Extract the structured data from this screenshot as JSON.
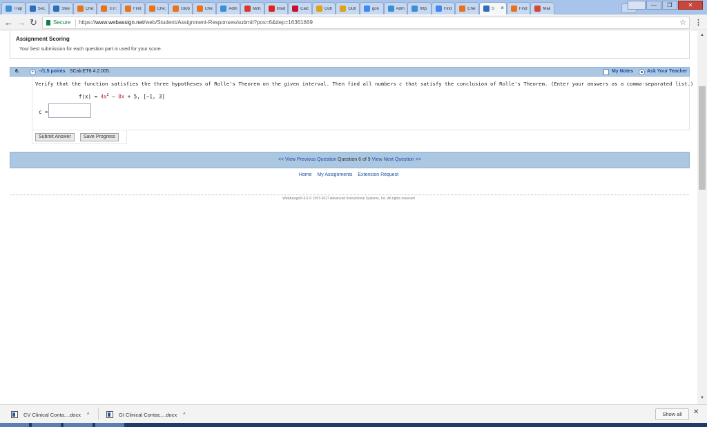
{
  "browser": {
    "tabs": [
      {
        "label": "Trap",
        "icon": "triangle-icon",
        "color": "#3d8fd4"
      },
      {
        "label": "Sec.",
        "icon": "webassign-icon",
        "color": "#2c6fb7"
      },
      {
        "label": "Stev",
        "icon": "webassign-icon",
        "color": "#2c6fb7"
      },
      {
        "label": "Che:",
        "icon": "chegg-icon",
        "color": "#e8731c"
      },
      {
        "label": "3.IT:",
        "icon": "chegg-icon",
        "color": "#e8731c"
      },
      {
        "label": "Find",
        "icon": "chegg-icon",
        "color": "#e8731c"
      },
      {
        "label": "Che;",
        "icon": "chegg-icon",
        "color": "#e8731c"
      },
      {
        "label": "Glob",
        "icon": "chegg-icon",
        "color": "#e8731c"
      },
      {
        "label": "Che:",
        "icon": "chegg-icon",
        "color": "#e8731c"
      },
      {
        "label": "Adm",
        "icon": "triangle-icon",
        "color": "#3d8fd4"
      },
      {
        "label": "McK",
        "icon": "mckesson-icon",
        "color": "#d63a2f"
      },
      {
        "label": "Insid",
        "icon": "youtube-icon",
        "color": "#e62117"
      },
      {
        "label": "Calc",
        "icon": "umd-icon",
        "color": "#c8102e"
      },
      {
        "label": "Outl",
        "icon": "outlook-icon",
        "color": "#e0a21b"
      },
      {
        "label": "Outl",
        "icon": "outlook-icon",
        "color": "#e0a21b"
      },
      {
        "label": "goo",
        "icon": "google-icon",
        "color": "#4285f4"
      },
      {
        "label": "Adm",
        "icon": "triangle-icon",
        "color": "#3d8fd4"
      },
      {
        "label": "http",
        "icon": "triangle-icon",
        "color": "#3d8fd4"
      },
      {
        "label": "Find",
        "icon": "google-icon",
        "color": "#4285f4"
      },
      {
        "label": "Che:",
        "icon": "chegg-icon",
        "color": "#e8731c"
      },
      {
        "label": "S",
        "icon": "webassign-icon",
        "color": "#2c6fb7",
        "active": true
      },
      {
        "label": "Find",
        "icon": "chegg-icon",
        "color": "#e8731c"
      },
      {
        "label": "Mail",
        "icon": "gmail-icon",
        "color": "#d44638"
      }
    ],
    "tab_close_glyph": "×",
    "window_controls": {
      "minimize": "—",
      "maximize": "❐",
      "close": "✕"
    },
    "address": {
      "secure_label": "Secure",
      "url_scheme": "https://",
      "url_host": "www.webassign.net",
      "url_path": "/web/Student/Assignment-Responses/submit?pos=6&dep=16361669"
    }
  },
  "page": {
    "scoring": {
      "title": "Assignment Scoring",
      "text": "Your best submission for each question part is used for your score."
    },
    "question": {
      "number": "6.",
      "points": "–/1.5 points",
      "code": "SCalcET8 4.2.005.",
      "my_notes": "My Notes",
      "ask_teacher": "Ask Your Teacher",
      "prompt_before": "Verify that the function satisfies the three hypotheses of Rolle's Theorem on the given interval. Then find all numbers ",
      "prompt_var": "c",
      "prompt_after": " that satisfy the conclusion of Rolle's Theorem. (Enter your answers as a comma-separated list.)",
      "formula_lhs": "f(x) = ",
      "formula_t1": "4x",
      "formula_exp": "2",
      "formula_mid": " − ",
      "formula_t2": "8x",
      "formula_rest": " + 5,   [−1, 3]",
      "answer_label": "c =",
      "answer_value": "",
      "submit_label": "Submit Answer",
      "save_label": "Save Progress"
    },
    "qnav": {
      "prev": "<< View Previous Question",
      "current": "Question 6 of 9",
      "next": "View Next Question >>"
    },
    "footer_links": [
      "Home",
      "My Assignments",
      "Extension Request"
    ],
    "copyright": "WebAssign® 4.0 © 1997-2017 Advanced Instructional Systems, Inc. All rights reserved"
  },
  "downloads": {
    "items": [
      {
        "name": "CV Clinical Conta....docx"
      },
      {
        "name": "GI Clinical Contac....docx"
      }
    ],
    "caret": "^",
    "show_all": "Show all",
    "close_glyph": "✕"
  },
  "colors": {
    "accent_blue": "#1c4fa3",
    "header_blue": "#abc7e2",
    "secure_green": "#0b8043",
    "formula_red": "#c0282d"
  }
}
